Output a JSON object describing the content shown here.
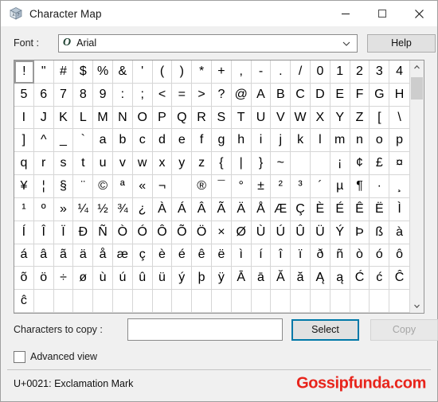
{
  "window": {
    "title": "Character Map",
    "icon": "character-map-cube-icon",
    "caption": {
      "minimize_label": "Minimize",
      "maximize_label": "Maximize",
      "close_label": "Close"
    }
  },
  "font_row": {
    "label": "Font :",
    "selected_font": "Arial",
    "font_type_icon": "O",
    "dropdown_icon": "chevron-down-icon",
    "help_label": "Help"
  },
  "grid": {
    "columns": 20,
    "rows": 11,
    "selected_index": 0,
    "cells": [
      "!",
      "\"",
      "#",
      "$",
      "%",
      "&",
      "'",
      "(",
      ")",
      "*",
      "+",
      ",",
      "-",
      ".",
      "/",
      "0",
      "1",
      "2",
      "3",
      "4",
      "5",
      "6",
      "7",
      "8",
      "9",
      ":",
      ";",
      "<",
      "=",
      ">",
      "?",
      "@",
      "A",
      "B",
      "C",
      "D",
      "E",
      "F",
      "G",
      "H",
      "I",
      "J",
      "K",
      "L",
      "M",
      "N",
      "O",
      "P",
      "Q",
      "R",
      "S",
      "T",
      "U",
      "V",
      "W",
      "X",
      "Y",
      "Z",
      "[",
      "\\",
      "]",
      "^",
      "_",
      "`",
      "a",
      "b",
      "c",
      "d",
      "e",
      "f",
      "g",
      "h",
      "i",
      "j",
      "k",
      "l",
      "m",
      "n",
      "o",
      "p",
      "q",
      "r",
      "s",
      "t",
      "u",
      "v",
      "w",
      "x",
      "y",
      "z",
      "{",
      "|",
      "}",
      "~",
      "",
      "",
      "¡",
      "¢",
      "£",
      "¤",
      "¥",
      "¦",
      "§",
      "¨",
      "©",
      "ª",
      "«",
      "¬",
      "­",
      "®",
      "¯",
      "°",
      "±",
      "²",
      "³",
      "´",
      "µ",
      "¶",
      "·",
      "¸",
      "¹",
      "º",
      "»",
      "¼",
      "½",
      "¾",
      "¿",
      "À",
      "Á",
      "Â",
      "Ã",
      "Ä",
      "Å",
      "Æ",
      "Ç",
      "È",
      "É",
      "Ê",
      "Ë",
      "Ì",
      "Í",
      "Î",
      "Ï",
      "Ð",
      "Ñ",
      "Ò",
      "Ó",
      "Ô",
      "Õ",
      "Ö",
      "×",
      "Ø",
      "Ù",
      "Ú",
      "Û",
      "Ü",
      "Ý",
      "Þ",
      "ß",
      "à",
      "á",
      "â",
      "ã",
      "ä",
      "å",
      "æ",
      "ç",
      "è",
      "é",
      "ê",
      "ë",
      "ì",
      "í",
      "î",
      "ï",
      "ð",
      "ñ",
      "ò",
      "ó",
      "ô",
      "õ",
      "ö",
      "÷",
      "ø",
      "ù",
      "ú",
      "û",
      "ü",
      "ý",
      "þ",
      "ÿ",
      "Ā",
      "ā",
      "Ă",
      "ă",
      "Ą",
      "ą",
      "Ć",
      "ć",
      "Ĉ",
      "ĉ",
      "",
      "",
      "",
      "",
      "",
      "",
      "",
      "",
      "",
      "",
      "",
      "",
      "",
      "",
      "",
      "",
      "",
      "",
      ""
    ]
  },
  "scrollbar": {
    "up_icon": "chevron-up-icon",
    "down_icon": "chevron-down-icon",
    "thumb_label": "scroll-thumb"
  },
  "copy_row": {
    "label": "Characters to copy :",
    "input_value": "",
    "input_placeholder": "",
    "select_label": "Select",
    "copy_label": "Copy",
    "copy_disabled": true
  },
  "advanced": {
    "label": "Advanced view",
    "checked": false
  },
  "statusbar": {
    "text": "U+0021: Exclamation Mark",
    "watermark": "Gossipfunda.com",
    "watermark_color": "#e8241b"
  }
}
